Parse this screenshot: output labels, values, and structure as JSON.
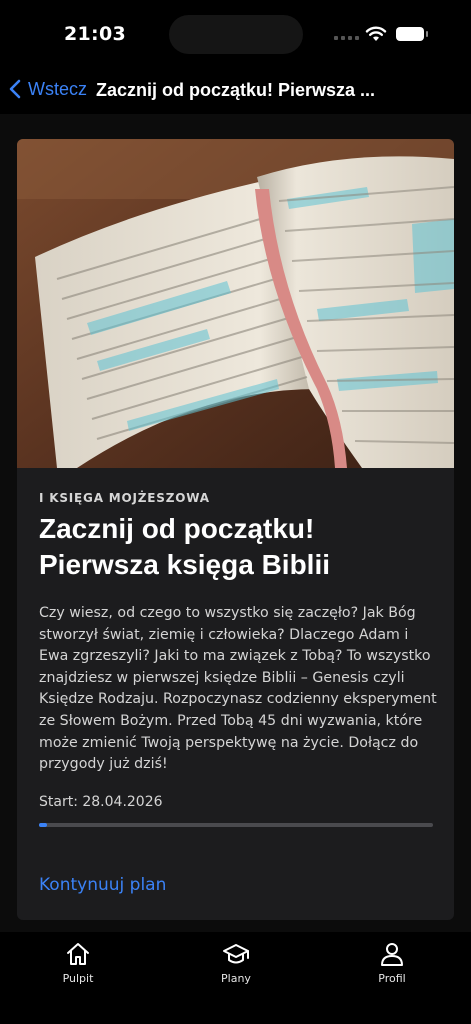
{
  "status_bar": {
    "time": "21:03"
  },
  "nav": {
    "back_label": "Wstecz",
    "title": "Zacznij od początku! Pierwsza ..."
  },
  "plan": {
    "category": "I KSIĘGA MOJŻESZOWA",
    "title": "Zacznij od początku! Pierwsza księga Biblii",
    "description": "Czy wiesz, od czego to wszystko się zaczęło? Jak Bóg stworzył świat, ziemię i człowieka? Dlaczego Adam i Ewa zgrzeszyli? Jaki to ma związek z Tobą? To wszystko znajdziesz w pierwszej księdze Biblii – Genesis czyli Księdze Rodzaju. Rozpoczynasz codzienny eksperyment ze Słowem Bożym. Przed Tobą 45 dni wyzwania, które może zmienić Twoją perspektywę na życie. Dołącz do przygody już dziś!",
    "start": "Start: 28.04.2026",
    "progress_percent": 2,
    "continue_label": "Kontynuuj plan",
    "hero_image": "open-bible-photo"
  },
  "tabs": [
    {
      "label": "Pulpit",
      "icon": "home-icon"
    },
    {
      "label": "Plany",
      "icon": "graduation-cap-icon"
    },
    {
      "label": "Profil",
      "icon": "person-icon"
    }
  ],
  "colors": {
    "accent": "#3b82f6",
    "card": "#1c1c1e",
    "background": "#0c0c0c"
  }
}
